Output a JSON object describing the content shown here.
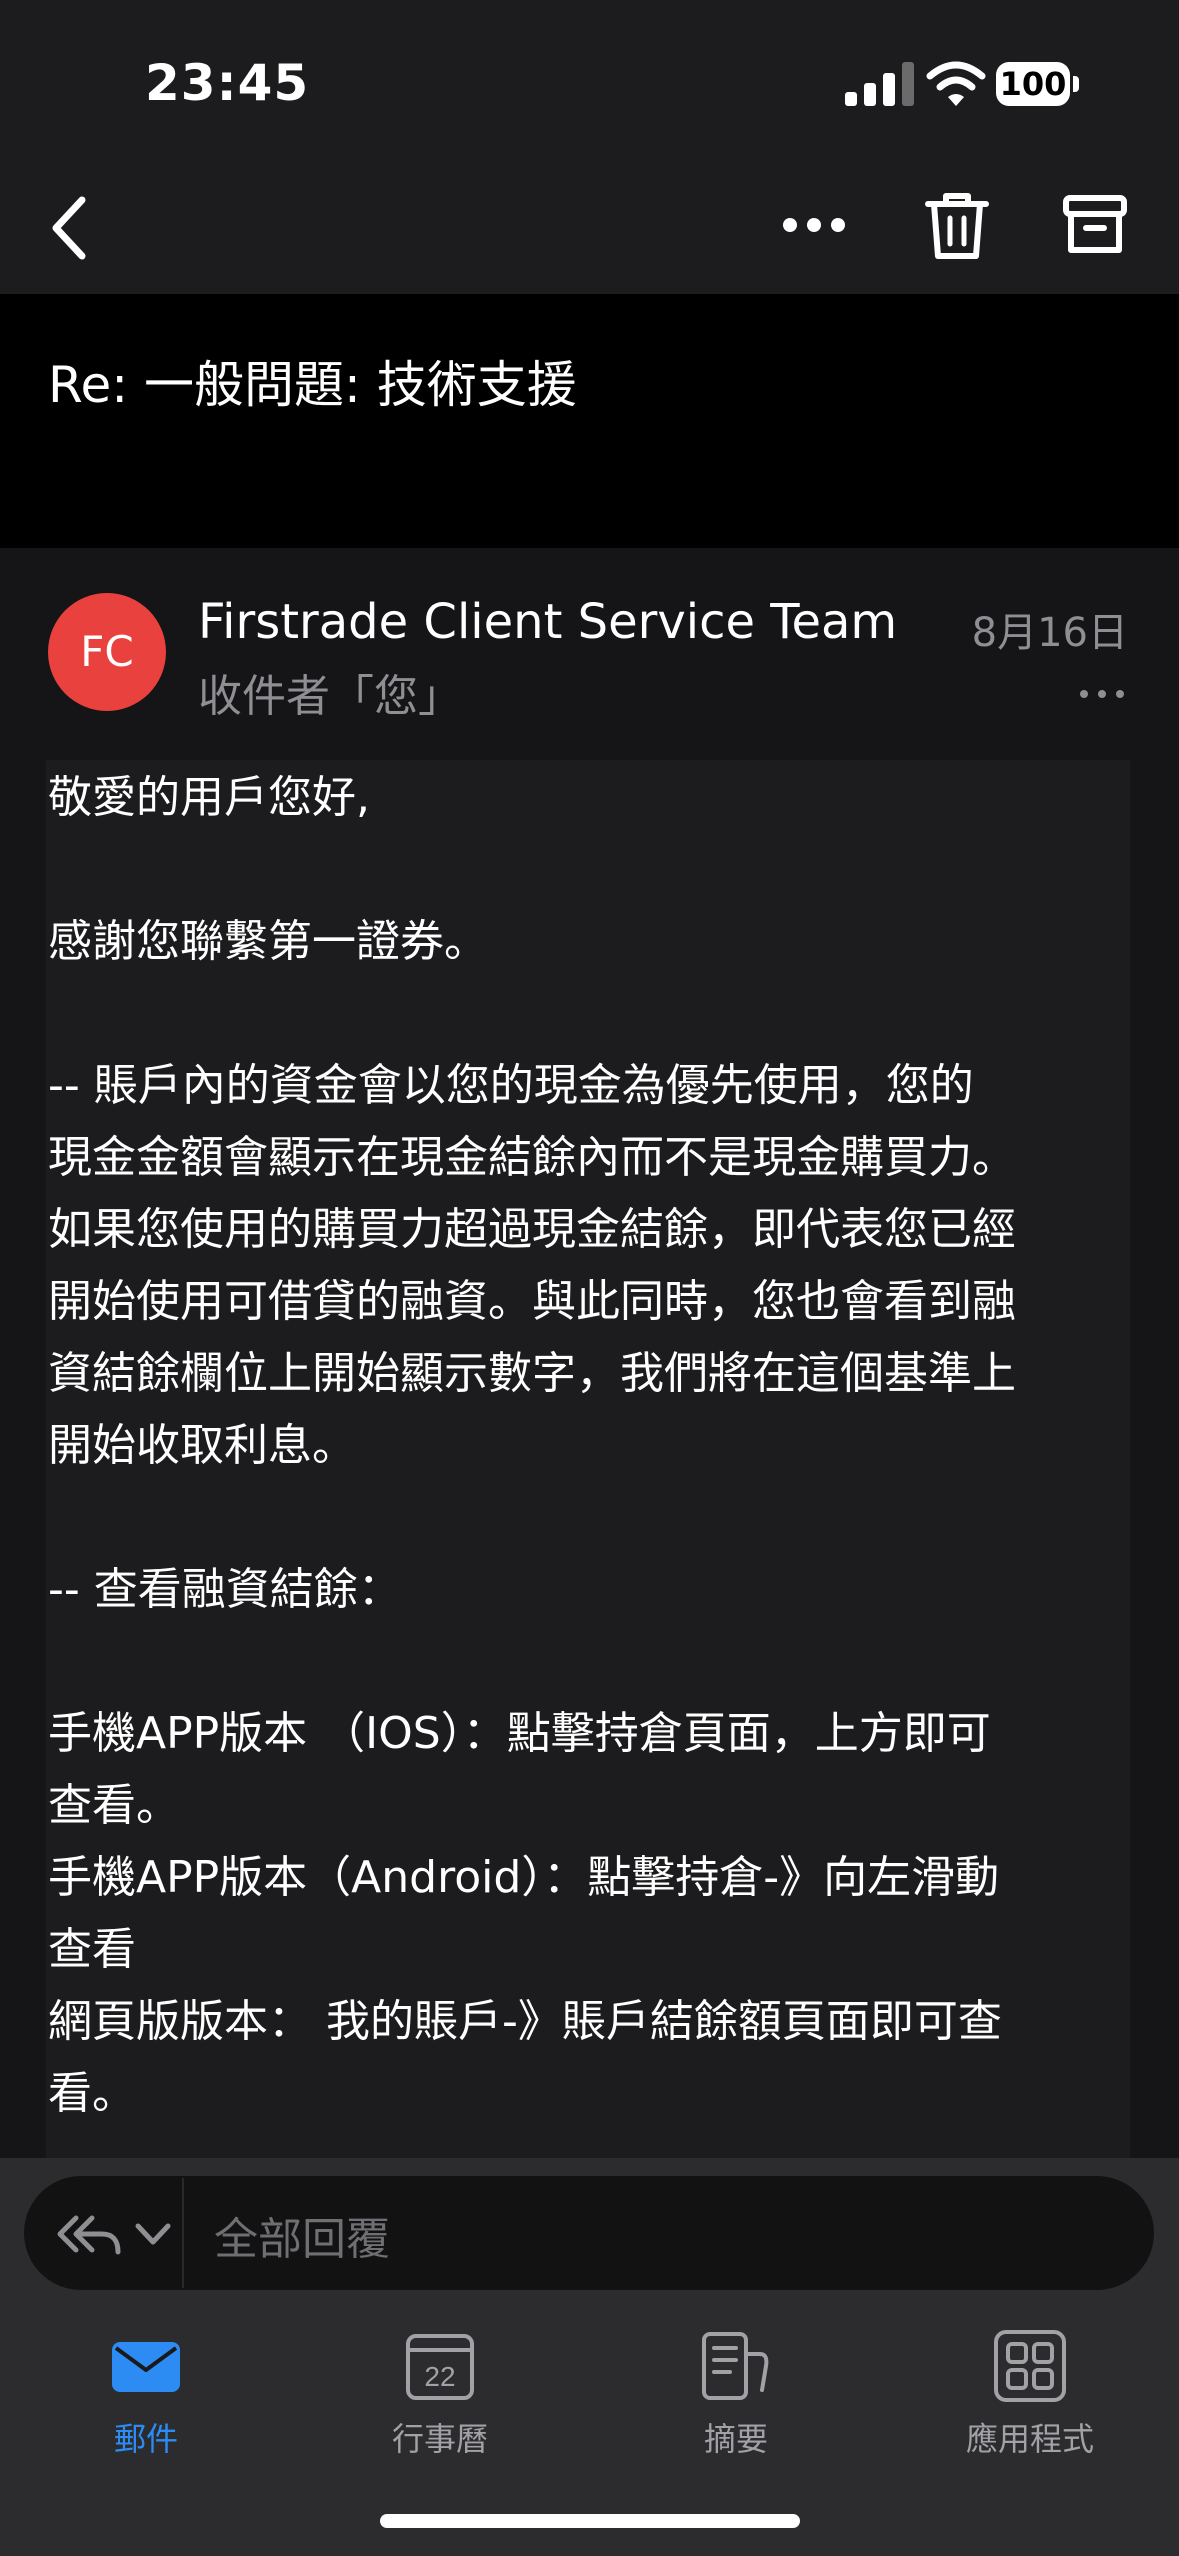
{
  "status_bar": {
    "time": "23:45",
    "battery": "100"
  },
  "toolbar": {
    "icons": [
      "back-icon",
      "more-icon",
      "trash-icon",
      "archive-icon"
    ]
  },
  "email": {
    "subject": "Re: 一般問題: 技術支援",
    "sender_initials": "FC",
    "sender_name": "Firstrade Client Service Team",
    "recipient": "收件者「您」",
    "date": "8月16日",
    "avatar_color": "#e9413d",
    "body": "敬愛的用戶您好,\n\n感謝您聯繫第一證券。\n\n-- 賬戶內的資金會以您的現金為優先使用，您的\n現金金額會顯示在現金結餘內而不是現金購買力。\n如果您使用的購買力超過現金結餘，即代表您已經\n開始使用可借貸的融資。與此同時，您也會看到融\n資結餘欄位上開始顯示數字，我們將在這個基準上\n開始收取利息。\n\n-- 查看融資結餘：\n\n手機APP版本 （IOS）：點擊持倉頁面，上方即可\n查看。\n手機APP版本（Android）：點擊持倉-》向左滑動\n查看\n網頁版版本： 我的賬戶-》賬戶結餘額頁面即可查\n看。"
  },
  "reply": {
    "placeholder": "全部回覆"
  },
  "tabs": [
    {
      "label": "郵件",
      "icon": "mail-icon",
      "active": true
    },
    {
      "label": "行事曆",
      "icon": "calendar-icon",
      "day": "22",
      "active": false
    },
    {
      "label": "摘要",
      "icon": "feed-icon",
      "active": false
    },
    {
      "label": "應用程式",
      "icon": "apps-icon",
      "active": false
    }
  ],
  "colors": {
    "accent": "#2c8cf4",
    "background": "#1c1c1e"
  }
}
